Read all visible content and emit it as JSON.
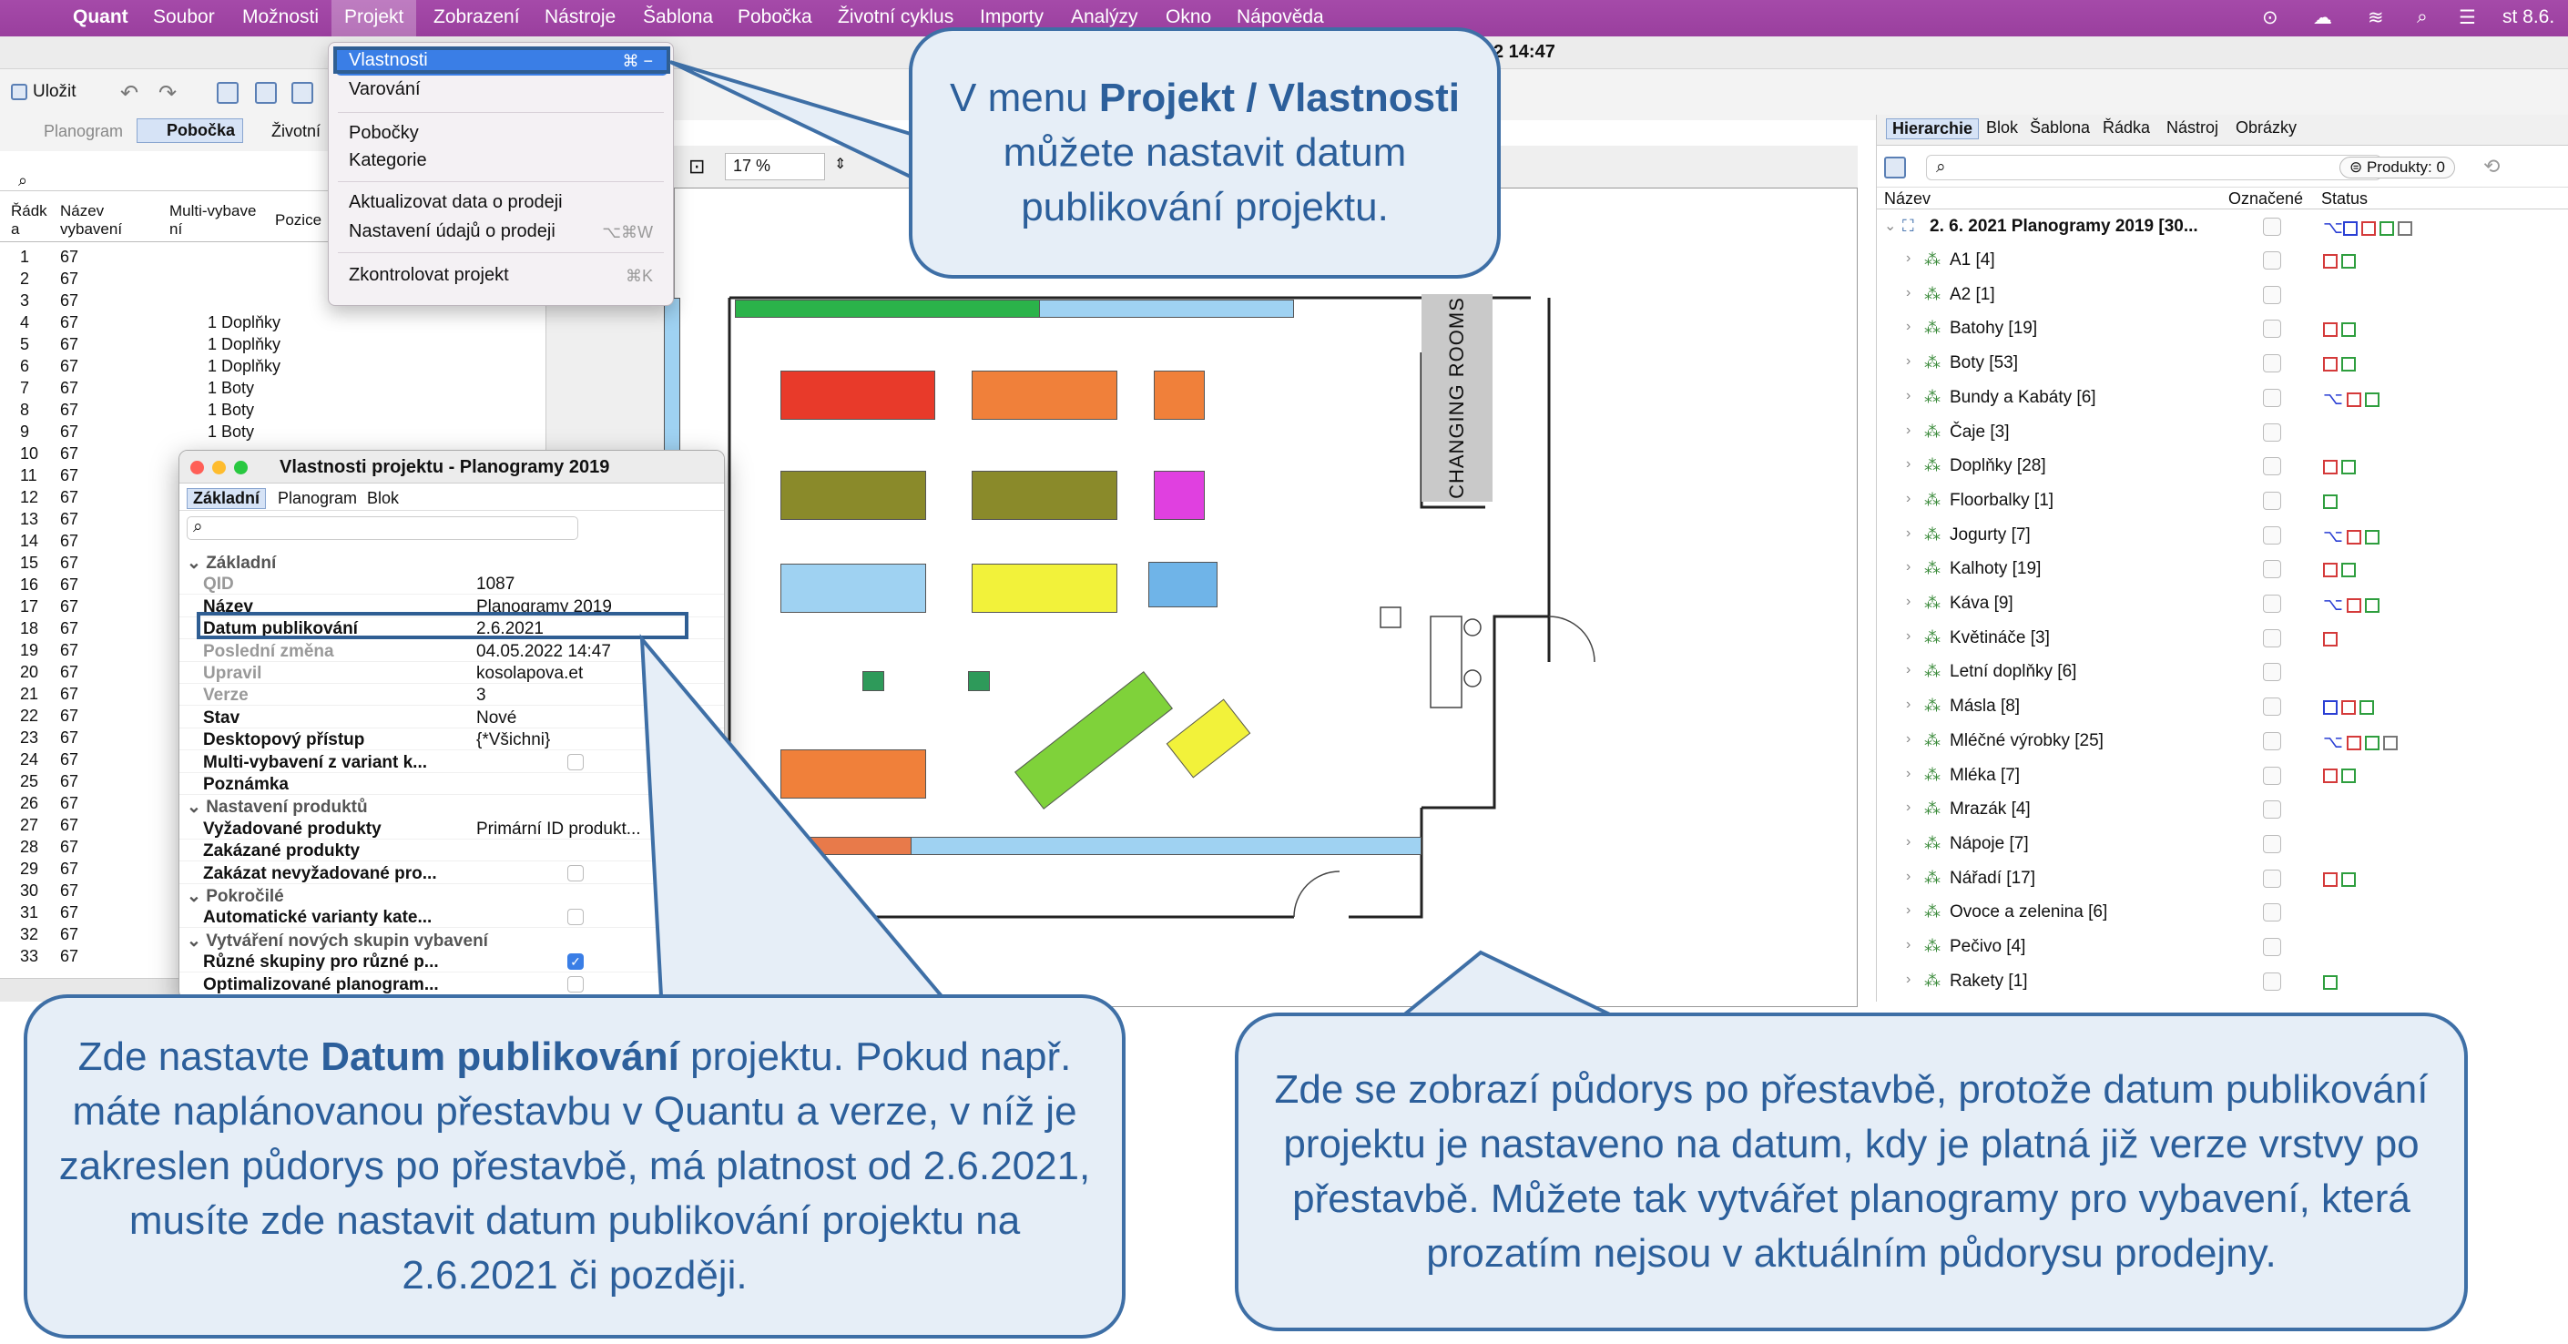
{
  "menubar": {
    "app": "Quant",
    "items": [
      "Soubor",
      "Možnosti",
      "Projekt",
      "Zobrazení",
      "Nástroje",
      "Šablona",
      "Pobočka",
      "Životní cyklus",
      "Importy",
      "Analýzy",
      "Okno",
      "Nápověda"
    ],
    "active": "Projekt",
    "clock": "st 8.6."
  },
  "window": {
    "title_time": "2 14:47"
  },
  "toolbar": {
    "save_label": "Uložit",
    "zoom": "17 %"
  },
  "tabs": {
    "planogram": "Planogram",
    "pobocka": "Pobočka",
    "zivotni": "Životní"
  },
  "projekt_menu": {
    "items": [
      {
        "label": "Vlastnosti",
        "shortcut": "⌘ −",
        "highlighted": true
      },
      {
        "label": "Varování",
        "shortcut": ""
      },
      {
        "label": "Pobočky",
        "shortcut": ""
      },
      {
        "label": "Kategorie",
        "shortcut": ""
      },
      {
        "label": "Aktualizovat data o prodeji",
        "shortcut": ""
      },
      {
        "label": "Nastavení údajů o prodeji",
        "shortcut": "⌥⌘W"
      },
      {
        "label": "Zkontrolovat projekt",
        "shortcut": "⌘K"
      }
    ]
  },
  "left_table": {
    "headers": [
      "Řádk a",
      "Název vybavení",
      "Multi-vybave ní",
      "Pozice"
    ],
    "rows": [
      [
        "1",
        "67",
        ""
      ],
      [
        "2",
        "67",
        ""
      ],
      [
        "3",
        "67",
        ""
      ],
      [
        "4",
        "67",
        "1 Doplňky"
      ],
      [
        "5",
        "67",
        "1 Doplňky"
      ],
      [
        "6",
        "67",
        "1 Doplňky"
      ],
      [
        "7",
        "67",
        "1 Boty"
      ],
      [
        "8",
        "67",
        "1 Boty"
      ],
      [
        "9",
        "67",
        "1 Boty"
      ],
      [
        "10",
        "67",
        ""
      ],
      [
        "11",
        "67",
        ""
      ],
      [
        "12",
        "67",
        ""
      ],
      [
        "13",
        "67",
        ""
      ],
      [
        "14",
        "67",
        ""
      ],
      [
        "15",
        "67",
        ""
      ],
      [
        "16",
        "67",
        ""
      ],
      [
        "17",
        "67",
        ""
      ],
      [
        "18",
        "67",
        ""
      ],
      [
        "19",
        "67",
        ""
      ],
      [
        "20",
        "67",
        ""
      ],
      [
        "21",
        "67",
        ""
      ],
      [
        "22",
        "67",
        ""
      ],
      [
        "23",
        "67",
        ""
      ],
      [
        "24",
        "67",
        ""
      ],
      [
        "25",
        "67",
        ""
      ],
      [
        "26",
        "67",
        ""
      ],
      [
        "27",
        "67",
        ""
      ],
      [
        "28",
        "67",
        ""
      ],
      [
        "29",
        "67",
        ""
      ],
      [
        "30",
        "67",
        ""
      ],
      [
        "31",
        "67",
        ""
      ],
      [
        "32",
        "67",
        ""
      ],
      [
        "33",
        "67",
        ""
      ]
    ]
  },
  "dialog": {
    "title": "Vlastnosti projektu - Planogramy 2019",
    "tabs": [
      "Základní",
      "Planogram",
      "Blok"
    ],
    "rows": [
      {
        "type": "section",
        "label": "Základní"
      },
      {
        "type": "prop",
        "key": "QID",
        "value": "1087",
        "gray": true
      },
      {
        "type": "prop",
        "key": "Název",
        "value": "Planogramy 2019"
      },
      {
        "type": "prop",
        "key": "Datum publikování",
        "value": "2.6.2021"
      },
      {
        "type": "prop",
        "key": "Poslední změna",
        "value": "04.05.2022 14:47",
        "gray": true
      },
      {
        "type": "prop",
        "key": "Upravil",
        "value": "kosolapova.et",
        "gray": true
      },
      {
        "type": "prop",
        "key": "Verze",
        "value": "3",
        "gray": true
      },
      {
        "type": "prop",
        "key": "Stav",
        "value": "Nové"
      },
      {
        "type": "prop",
        "key": "Desktopový přístup",
        "value": "{*Všichni}"
      },
      {
        "type": "prop",
        "key": "Multi-vybavení z variant k...",
        "value": ""
      },
      {
        "type": "prop",
        "key": "Poznámka",
        "value": ""
      },
      {
        "type": "section",
        "label": "Nastavení produktů"
      },
      {
        "type": "prop",
        "key": "Vyžadované produkty",
        "value": "Primární ID produkt..."
      },
      {
        "type": "prop",
        "key": "Zakázané produkty",
        "value": ""
      },
      {
        "type": "prop",
        "key": "Zakázat nevyžadované pro...",
        "value": ""
      },
      {
        "type": "section",
        "label": "Pokročilé"
      },
      {
        "type": "prop",
        "key": "Automatické varianty kate...",
        "value": ""
      },
      {
        "type": "section",
        "label": "Vytváření nových skupin vybavení"
      },
      {
        "type": "prop",
        "key": "Různé skupiny pro různé p...",
        "value": ""
      },
      {
        "type": "prop",
        "key": "Optimalizované planogram...",
        "value": ""
      }
    ]
  },
  "canvas": {
    "changing_rooms": "CHANGING ROOMS"
  },
  "right_panel": {
    "tabs": [
      "Hierarchie",
      "Blok",
      "Šablona",
      "Řádka",
      "Nástroj",
      "Obrázky"
    ],
    "filter_label": "Produkty: 0",
    "headers": {
      "name": "Název",
      "marked": "Označené",
      "status": "Status"
    },
    "root": "2. 6. 2021 Planogramy 2019 [30...",
    "items": [
      {
        "name": "A1 [4]",
        "status": "rg"
      },
      {
        "name": "A2 [1]",
        "status": ""
      },
      {
        "name": "Batohy [19]",
        "status": "rg"
      },
      {
        "name": "Boty [53]",
        "status": "rg"
      },
      {
        "name": "Bundy a Kabáty [6]",
        "status": "xrg"
      },
      {
        "name": "Čaje [3]",
        "status": ""
      },
      {
        "name": "Doplňky [28]",
        "status": "rg"
      },
      {
        "name": "Floorbalky [1]",
        "status": "g"
      },
      {
        "name": "Jogurty [7]",
        "status": "xrg"
      },
      {
        "name": "Kalhoty [19]",
        "status": "rg"
      },
      {
        "name": "Káva [9]",
        "status": "xrg"
      },
      {
        "name": "Květináče [3]",
        "status": "r"
      },
      {
        "name": "Letní doplňky [6]",
        "status": ""
      },
      {
        "name": "Másla [8]",
        "status": "brg"
      },
      {
        "name": "Mléčné výrobky [25]",
        "status": "xrgt"
      },
      {
        "name": "Mléka [7]",
        "status": "rg"
      },
      {
        "name": "Mrazák [4]",
        "status": ""
      },
      {
        "name": "Nápoje [7]",
        "status": ""
      },
      {
        "name": "Nářadí [17]",
        "status": "rg"
      },
      {
        "name": "Ovoce a zelenina [6]",
        "status": ""
      },
      {
        "name": "Pečivo [4]",
        "status": ""
      },
      {
        "name": "Rakety [1]",
        "status": "g"
      }
    ]
  },
  "callouts": {
    "top": {
      "pre": "V menu ",
      "bold": "Projekt / Vlastnosti",
      "post": " můžete nastavit datum publikování projektu."
    },
    "left": {
      "pre": "Zde nastavte ",
      "bold": "Datum publikování",
      "post": " projektu. Pokud např. máte naplánovanou přestavbu v Quantu a verze, v níž je zakreslen půdorys po přestavbě, má platnost od 2.6.2021, musíte zde nastavit datum publikování projektu na 2.6.2021 či později."
    },
    "right": {
      "text": "Zde se zobrazí půdorys po přestavbě, protože datum publikování projektu je nastaveno na datum, kdy je platná již verze vrstvy po přestavbě. Můžete tak vytvářet planogramy pro vybavení, která prozatím nejsou v aktuálním půdorysu prodejny."
    }
  },
  "colors": {
    "menubar": "#9a3f9e",
    "accent": "#3a7ee6",
    "callout_border": "#3e6fa6",
    "callout_text": "#2c5f9b"
  }
}
